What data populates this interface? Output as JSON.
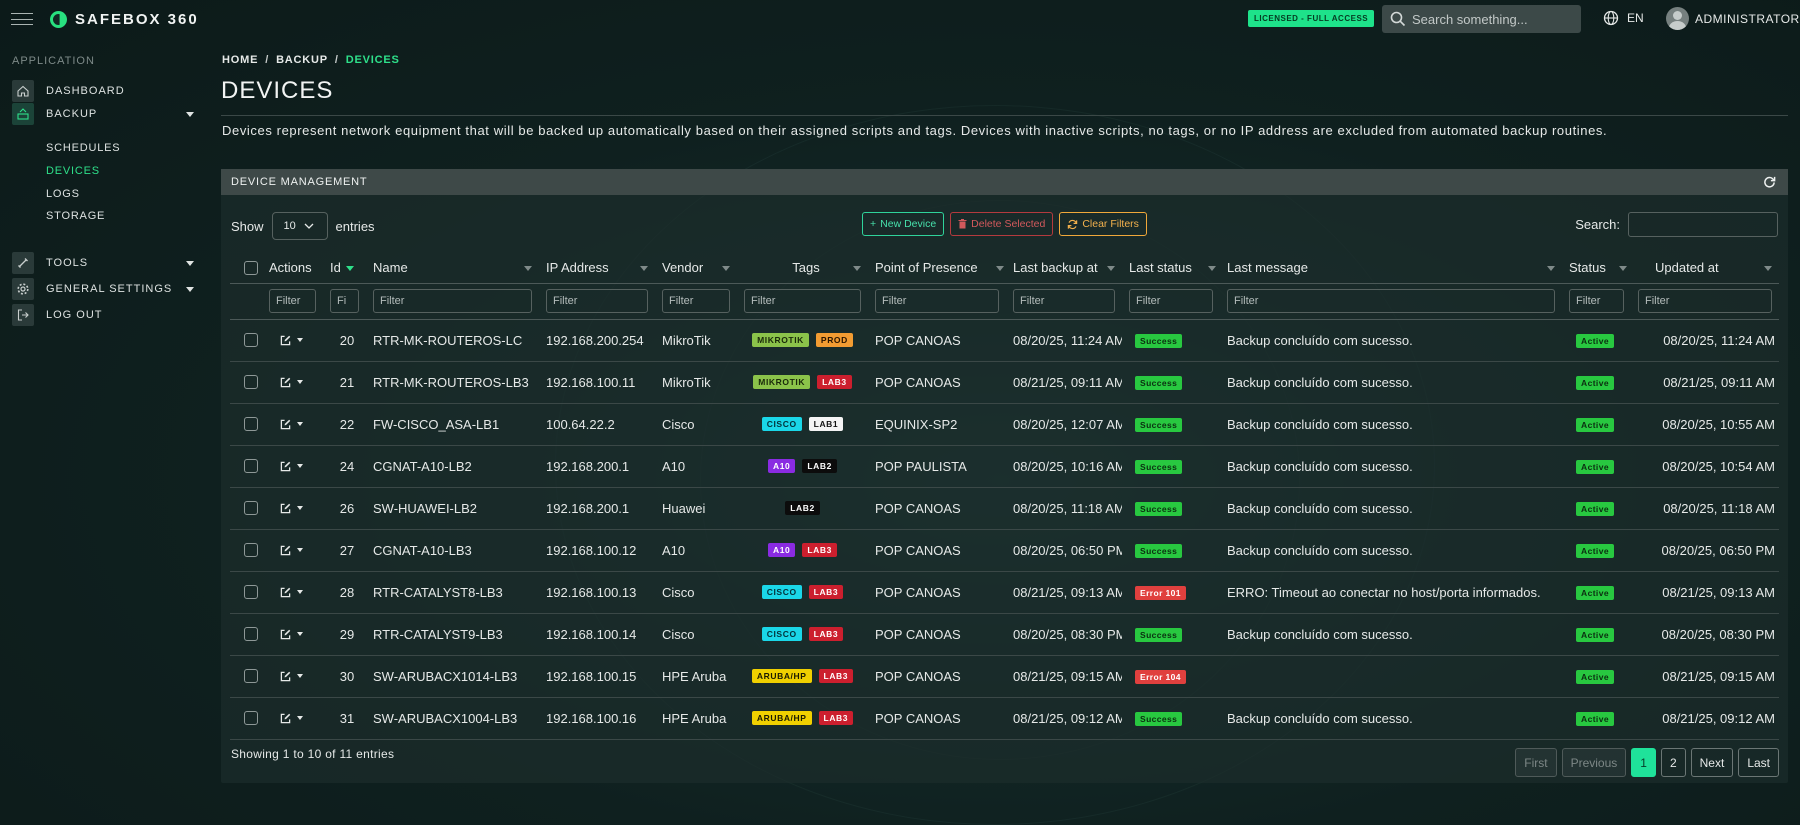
{
  "app": {
    "brand": "SAFEBOX 360",
    "license": "LICENSED - FULL ACCESS",
    "search_placeholder": "Search something...",
    "lang": "EN",
    "user": "ADMINISTRATOR"
  },
  "sidebar": {
    "section": "APPLICATION",
    "dashboard": "DASHBOARD",
    "backup": "BACKUP",
    "sub": [
      "SCHEDULES",
      "DEVICES",
      "LOGS",
      "STORAGE"
    ],
    "tools": "TOOLS",
    "general": "GENERAL SETTINGS",
    "logout": "LOG OUT"
  },
  "page": {
    "crumb": [
      "HOME",
      "BACKUP",
      "DEVICES"
    ],
    "title": "DEVICES",
    "description": "Devices represent network equipment that will be backed up automatically based on their assigned scripts and tags. Devices with inactive scripts, no tags, or no IP address are excluded from automated backup routines."
  },
  "card": {
    "title": "DEVICE MANAGEMENT",
    "show": "Show",
    "entries_value": "10",
    "entries": "entries",
    "new_device": "New Device",
    "delete_selected": "Delete Selected",
    "clear_filters": "Clear Filters",
    "search": "Search:"
  },
  "table": {
    "columns": [
      "Actions",
      "Id",
      "Name",
      "IP Address",
      "Vendor",
      "Tags",
      "Point of Presence",
      "Last backup at",
      "Last status",
      "Last message",
      "Status",
      "Updated at"
    ],
    "filter": "Filter",
    "filter_short": "Fi",
    "rows": [
      {
        "id": "20",
        "name": "RTR-MK-ROUTEROS-LC",
        "ip": "192.168.200.254",
        "vendor": "MikroTik",
        "tags": [
          {
            "t": "MIKROTIK",
            "bg": "#8bc34a",
            "fg": "#1a2a0a"
          },
          {
            "t": "PROD",
            "bg": "#f39c32",
            "fg": "#2a1500"
          }
        ],
        "pop": "POP CANOAS",
        "last_backup": "08/20/25, 11:24 AM",
        "last_status": "Success",
        "last_status_color": "#28c840",
        "message": "Backup concluído com sucesso.",
        "status": "Active",
        "updated": "08/20/25, 11:24 AM"
      },
      {
        "id": "21",
        "name": "RTR-MK-ROUTEROS-LB3",
        "ip": "192.168.100.11",
        "vendor": "MikroTik",
        "tags": [
          {
            "t": "MIKROTIK",
            "bg": "#8bc34a",
            "fg": "#1a2a0a"
          },
          {
            "t": "LAB3",
            "bg": "#cc1f2e",
            "fg": "#ffffff"
          }
        ],
        "pop": "POP CANOAS",
        "last_backup": "08/21/25, 09:11 AM",
        "last_status": "Success",
        "last_status_color": "#28c840",
        "message": "Backup concluído com sucesso.",
        "status": "Active",
        "updated": "08/21/25, 09:11 AM"
      },
      {
        "id": "22",
        "name": "FW-CISCO_ASA-LB1",
        "ip": "100.64.22.2",
        "vendor": "Cisco",
        "tags": [
          {
            "t": "CISCO",
            "bg": "#1ad7e8",
            "fg": "#02323a"
          },
          {
            "t": "LAB1",
            "bg": "#f4f4f4",
            "fg": "#111111"
          }
        ],
        "pop": "EQUINIX-SP2",
        "last_backup": "08/20/25, 12:07 AM",
        "last_status": "Success",
        "last_status_color": "#28c840",
        "message": "Backup concluído com sucesso.",
        "status": "Active",
        "updated": "08/20/25, 10:55 AM"
      },
      {
        "id": "24",
        "name": "CGNAT-A10-LB2",
        "ip": "192.168.200.1",
        "vendor": "A10",
        "tags": [
          {
            "t": "A10",
            "bg": "#8a2be2",
            "fg": "#ffffff"
          },
          {
            "t": "LAB2",
            "bg": "#0c0c0c",
            "fg": "#ffffff"
          }
        ],
        "pop": "POP PAULISTA",
        "last_backup": "08/20/25, 10:16 AM",
        "last_status": "Success",
        "last_status_color": "#28c840",
        "message": "Backup concluído com sucesso.",
        "status": "Active",
        "updated": "08/20/25, 10:54 AM"
      },
      {
        "id": "26",
        "name": "SW-HUAWEI-LB2",
        "ip": "192.168.200.1",
        "vendor": "Huawei",
        "tags": [
          {
            "t": "LAB2",
            "bg": "#0c0c0c",
            "fg": "#ffffff"
          }
        ],
        "pop": "POP CANOAS",
        "last_backup": "08/20/25, 11:18 AM",
        "last_status": "Success",
        "last_status_color": "#28c840",
        "message": "Backup concluído com sucesso.",
        "status": "Active",
        "updated": "08/20/25, 11:18 AM"
      },
      {
        "id": "27",
        "name": "CGNAT-A10-LB3",
        "ip": "192.168.100.12",
        "vendor": "A10",
        "tags": [
          {
            "t": "A10",
            "bg": "#8a2be2",
            "fg": "#ffffff"
          },
          {
            "t": "LAB3",
            "bg": "#cc1f2e",
            "fg": "#ffffff"
          }
        ],
        "pop": "POP CANOAS",
        "last_backup": "08/20/25, 06:50 PM",
        "last_status": "Success",
        "last_status_color": "#28c840",
        "message": "Backup concluído com sucesso.",
        "status": "Active",
        "updated": "08/20/25, 06:50 PM"
      },
      {
        "id": "28",
        "name": "RTR-CATALYST8-LB3",
        "ip": "192.168.100.13",
        "vendor": "Cisco",
        "tags": [
          {
            "t": "CISCO",
            "bg": "#1ad7e8",
            "fg": "#02323a"
          },
          {
            "t": "LAB3",
            "bg": "#cc1f2e",
            "fg": "#ffffff"
          }
        ],
        "pop": "POP CANOAS",
        "last_backup": "08/21/25, 09:13 AM",
        "last_status": "Error 101",
        "last_status_color": "#e0403e",
        "message": "ERRO: Timeout ao conectar no host/porta informados.",
        "status": "Active",
        "updated": "08/21/25, 09:13 AM"
      },
      {
        "id": "29",
        "name": "RTR-CATALYST9-LB3",
        "ip": "192.168.100.14",
        "vendor": "Cisco",
        "tags": [
          {
            "t": "CISCO",
            "bg": "#1ad7e8",
            "fg": "#02323a"
          },
          {
            "t": "LAB3",
            "bg": "#cc1f2e",
            "fg": "#ffffff"
          }
        ],
        "pop": "POP CANOAS",
        "last_backup": "08/20/25, 08:30 PM",
        "last_status": "Success",
        "last_status_color": "#28c840",
        "message": "Backup concluído com sucesso.",
        "status": "Active",
        "updated": "08/20/25, 08:30 PM"
      },
      {
        "id": "30",
        "name": "SW-ARUBACX1014-LB3",
        "ip": "192.168.100.15",
        "vendor": "HPE Aruba",
        "tags": [
          {
            "t": "ARUBA/HP",
            "bg": "#f0d000",
            "fg": "#1b1a00"
          },
          {
            "t": "LAB3",
            "bg": "#cc1f2e",
            "fg": "#ffffff"
          }
        ],
        "pop": "POP CANOAS",
        "last_backup": "08/21/25, 09:15 AM",
        "last_status": "Error 104",
        "last_status_color": "#e0403e",
        "message": "",
        "status": "Active",
        "updated": "08/21/25, 09:15 AM"
      },
      {
        "id": "31",
        "name": "SW-ARUBACX1004-LB3",
        "ip": "192.168.100.16",
        "vendor": "HPE Aruba",
        "tags": [
          {
            "t": "ARUBA/HP",
            "bg": "#f0d000",
            "fg": "#1b1a00"
          },
          {
            "t": "LAB3",
            "bg": "#cc1f2e",
            "fg": "#ffffff"
          }
        ],
        "pop": "POP CANOAS",
        "last_backup": "08/21/25, 09:12 AM",
        "last_status": "Success",
        "last_status_color": "#28c840",
        "message": "Backup concluído com sucesso.",
        "status": "Active",
        "updated": "08/21/25, 09:12 AM"
      }
    ]
  },
  "footer": {
    "info": "Showing 1 to 10 of 11 entries",
    "pages": [
      "First",
      "Previous",
      "1",
      "2",
      "Next",
      "Last"
    ]
  },
  "colors": {
    "accent": "#2ee08a",
    "success": "#28c840",
    "error": "#e0403e",
    "active": "#28c840"
  }
}
